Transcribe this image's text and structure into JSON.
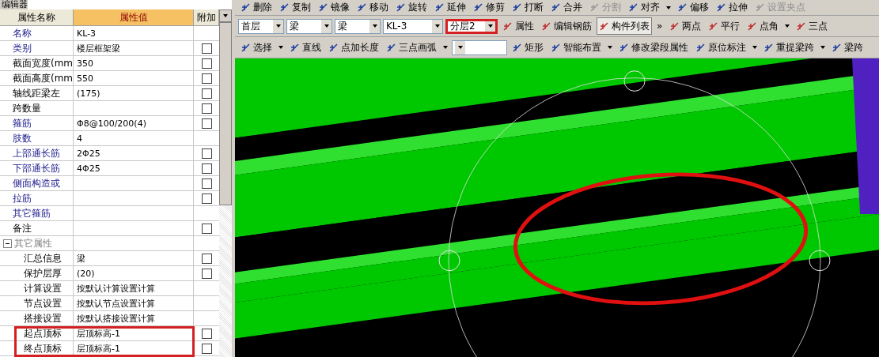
{
  "panel": {
    "title": "编辑器",
    "columns": [
      "属性名称",
      "属性值",
      "附加"
    ],
    "rows": [
      {
        "name": "名称",
        "value": "KL-3",
        "kind": "main",
        "has_checkbox": false,
        "highlighted": false
      },
      {
        "name": "类别",
        "value": "楼层框架梁",
        "kind": "main",
        "has_checkbox": true,
        "checked": false,
        "highlighted": false
      },
      {
        "name": "截面宽度(mm",
        "value": "350",
        "kind": "plain",
        "has_checkbox": true,
        "checked": false,
        "highlighted": false
      },
      {
        "name": "截面高度(mm",
        "value": "550",
        "kind": "plain",
        "has_checkbox": true,
        "checked": false,
        "highlighted": false
      },
      {
        "name": "轴线距梁左",
        "value": "(175)",
        "kind": "plain",
        "has_checkbox": true,
        "checked": false,
        "highlighted": false
      },
      {
        "name": "跨数量",
        "kind": "plain",
        "has_checkbox": true,
        "checked": false,
        "highlighted": false
      },
      {
        "name": "箍筋",
        "value": "Φ8@100/200(4)",
        "kind": "main",
        "has_checkbox": true,
        "checked": false,
        "highlighted": false
      },
      {
        "name": "肢数",
        "value": "4",
        "kind": "main",
        "has_checkbox": false,
        "highlighted": false
      },
      {
        "name": "上部通长筋",
        "value": "2Φ25",
        "kind": "main",
        "has_checkbox": true,
        "checked": false,
        "highlighted": false
      },
      {
        "name": "下部通长筋",
        "value": "4Φ25",
        "kind": "main",
        "has_checkbox": true,
        "checked": false,
        "highlighted": false
      },
      {
        "name": "侧面构造或",
        "kind": "main",
        "has_checkbox": true,
        "checked": false,
        "highlighted": false
      },
      {
        "name": "拉筋",
        "kind": "main",
        "has_checkbox": true,
        "checked": false,
        "highlighted": false
      },
      {
        "name": "其它箍筋",
        "kind": "main",
        "has_checkbox": false,
        "highlighted": false
      },
      {
        "name": "备注",
        "kind": "plain",
        "has_checkbox": true,
        "checked": false,
        "highlighted": false
      },
      {
        "name": "其它属性",
        "kind": "group",
        "expanded": true,
        "children": [
          {
            "name": "汇总信息",
            "value": "梁",
            "kind": "plain",
            "has_checkbox": true,
            "checked": false,
            "highlighted": false
          },
          {
            "name": "保护层厚",
            "value": "(20)",
            "kind": "plain",
            "has_checkbox": true,
            "checked": false,
            "highlighted": false
          },
          {
            "name": "计算设置",
            "value": "按默认计算设置计算",
            "kind": "plain",
            "has_checkbox": false,
            "highlighted": false
          },
          {
            "name": "节点设置",
            "value": "按默认节点设置计算",
            "kind": "plain",
            "has_checkbox": false,
            "highlighted": false
          },
          {
            "name": "搭接设置",
            "value": "按默认搭接设置计算",
            "kind": "plain",
            "has_checkbox": false,
            "highlighted": false
          },
          {
            "name": "起点顶标",
            "value": "层顶标高-1",
            "kind": "plain",
            "has_checkbox": true,
            "checked": false,
            "highlighted": true
          },
          {
            "name": "终点顶标",
            "value": "层顶标高-1",
            "kind": "plain",
            "has_checkbox": true,
            "checked": false,
            "highlighted": true
          }
        ]
      }
    ]
  },
  "toolbar_1": [
    {
      "label": "删除",
      "has_menu": false,
      "disabled": false
    },
    {
      "label": "复制",
      "has_menu": false,
      "disabled": false
    },
    {
      "label": "镜像",
      "has_menu": false,
      "disabled": false
    },
    {
      "label": "移动",
      "has_menu": false,
      "disabled": false
    },
    {
      "label": "旋转",
      "has_menu": false,
      "disabled": false
    },
    {
      "label": "延伸",
      "has_menu": false,
      "disabled": false
    },
    {
      "label": "修剪",
      "has_menu": false,
      "disabled": false
    },
    {
      "label": "打断",
      "has_menu": false,
      "disabled": false
    },
    {
      "label": "合并",
      "has_menu": false,
      "disabled": false
    },
    {
      "label": "分割",
      "has_menu": false,
      "disabled": true
    },
    {
      "label": "对齐",
      "has_menu": true,
      "disabled": false
    },
    {
      "label": "偏移",
      "has_menu": false,
      "disabled": false
    },
    {
      "label": "拉伸",
      "has_menu": false,
      "disabled": false
    },
    {
      "label": "设置夹点",
      "has_menu": false,
      "disabled": true
    }
  ],
  "toolbar_2": [
    {
      "kind": "combo",
      "value": "首层",
      "highlighted": false
    },
    {
      "kind": "combo",
      "value": "梁",
      "highlighted": false
    },
    {
      "kind": "combo",
      "value": "梁",
      "highlighted": false
    },
    {
      "kind": "combo",
      "value": "KL-3",
      "highlighted": false
    },
    {
      "kind": "combo",
      "value": "分层2",
      "highlighted": true
    },
    {
      "kind": "button",
      "label": "属性",
      "has_menu": false,
      "selected": false
    },
    {
      "kind": "button",
      "label": "编辑钢筋",
      "has_menu": false,
      "selected": false
    },
    {
      "kind": "button",
      "label": "构件列表",
      "has_menu": false,
      "selected": true
    },
    {
      "kind": "more",
      "label": "»"
    },
    {
      "kind": "button",
      "label": "两点",
      "has_menu": false,
      "selected": false
    },
    {
      "kind": "button",
      "label": "平行",
      "has_menu": false,
      "selected": false
    },
    {
      "kind": "button",
      "label": "点角",
      "has_menu": true,
      "selected": false
    },
    {
      "kind": "button",
      "label": "三点",
      "has_menu": false,
      "selected": false
    }
  ],
  "toolbar_3": [
    {
      "kind": "button",
      "label": "选择",
      "has_menu": true
    },
    {
      "kind": "button",
      "label": "直线",
      "has_menu": false
    },
    {
      "kind": "button",
      "label": "点加长度",
      "has_menu": false
    },
    {
      "kind": "button",
      "label": "三点画弧",
      "has_menu": true
    },
    {
      "kind": "combo"
    },
    {
      "kind": "button",
      "label": "矩形",
      "has_menu": false
    },
    {
      "kind": "button",
      "label": "智能布置",
      "has_menu": true
    },
    {
      "kind": "button",
      "label": "修改梁段属性",
      "has_menu": false
    },
    {
      "kind": "button",
      "label": "原位标注",
      "has_menu": true
    },
    {
      "kind": "button",
      "label": "重提梁跨",
      "has_menu": true
    },
    {
      "kind": "button",
      "label": "梁跨",
      "has_menu": false
    }
  ]
}
